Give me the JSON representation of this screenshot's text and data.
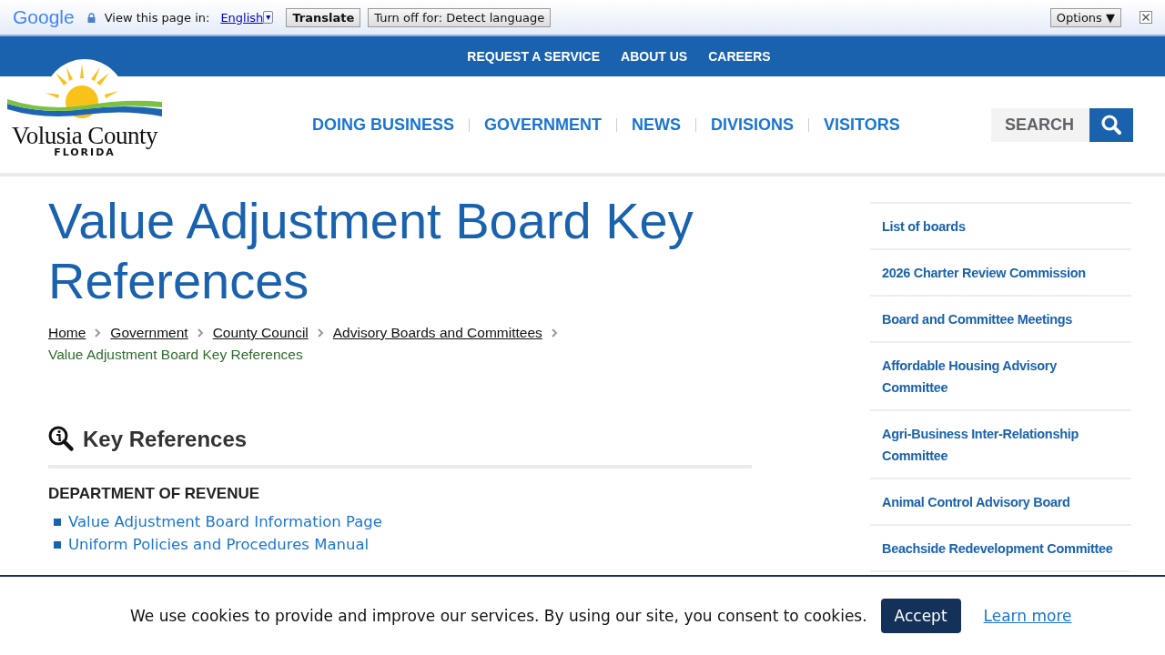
{
  "translate_bar": {
    "brand": "Google",
    "prompt": "View this page in:",
    "language": "English",
    "language_arrow": "▾",
    "translate_button": "Translate",
    "turn_off_button": "Turn off for: Detect language",
    "options_button": "Options ▼"
  },
  "top_links": [
    "REQUEST A SERVICE",
    "ABOUT US",
    "CAREERS"
  ],
  "logo": {
    "name": "Volusia County",
    "state": "FLORIDA"
  },
  "main_nav": [
    "DOING BUSINESS",
    "GOVERNMENT",
    "NEWS",
    "DIVISIONS",
    "VISITORS"
  ],
  "search": {
    "placeholder": "SEARCH"
  },
  "page_title": "Value Adjustment Board Key References",
  "breadcrumbs": [
    {
      "label": "Home",
      "current": false
    },
    {
      "label": "Government",
      "current": false
    },
    {
      "label": "County Council",
      "current": false
    },
    {
      "label": "Advisory Boards and Committees",
      "current": false
    },
    {
      "label": "Value Adjustment Board Key References",
      "current": true
    }
  ],
  "section": {
    "title": "Key References",
    "subheading": "DEPARTMENT OF REVENUE",
    "links": [
      "Value Adjustment Board Information Page",
      "Uniform Policies and Procedures Manual"
    ]
  },
  "sidebar": {
    "items": [
      "List of boards",
      "2026 Charter Review Commission",
      "Board and Committee Meetings",
      "Affordable Housing Advisory Committee",
      "Agri-Business Inter-Relationship Committee",
      "Animal Control Advisory Board",
      "Beachside Redevelopment Committee"
    ]
  },
  "cookie_banner": {
    "message": "We use cookies to provide and improve our services. By using our site, you consent to cookies.",
    "accept_button": "Accept",
    "learn_more": "Learn more"
  }
}
